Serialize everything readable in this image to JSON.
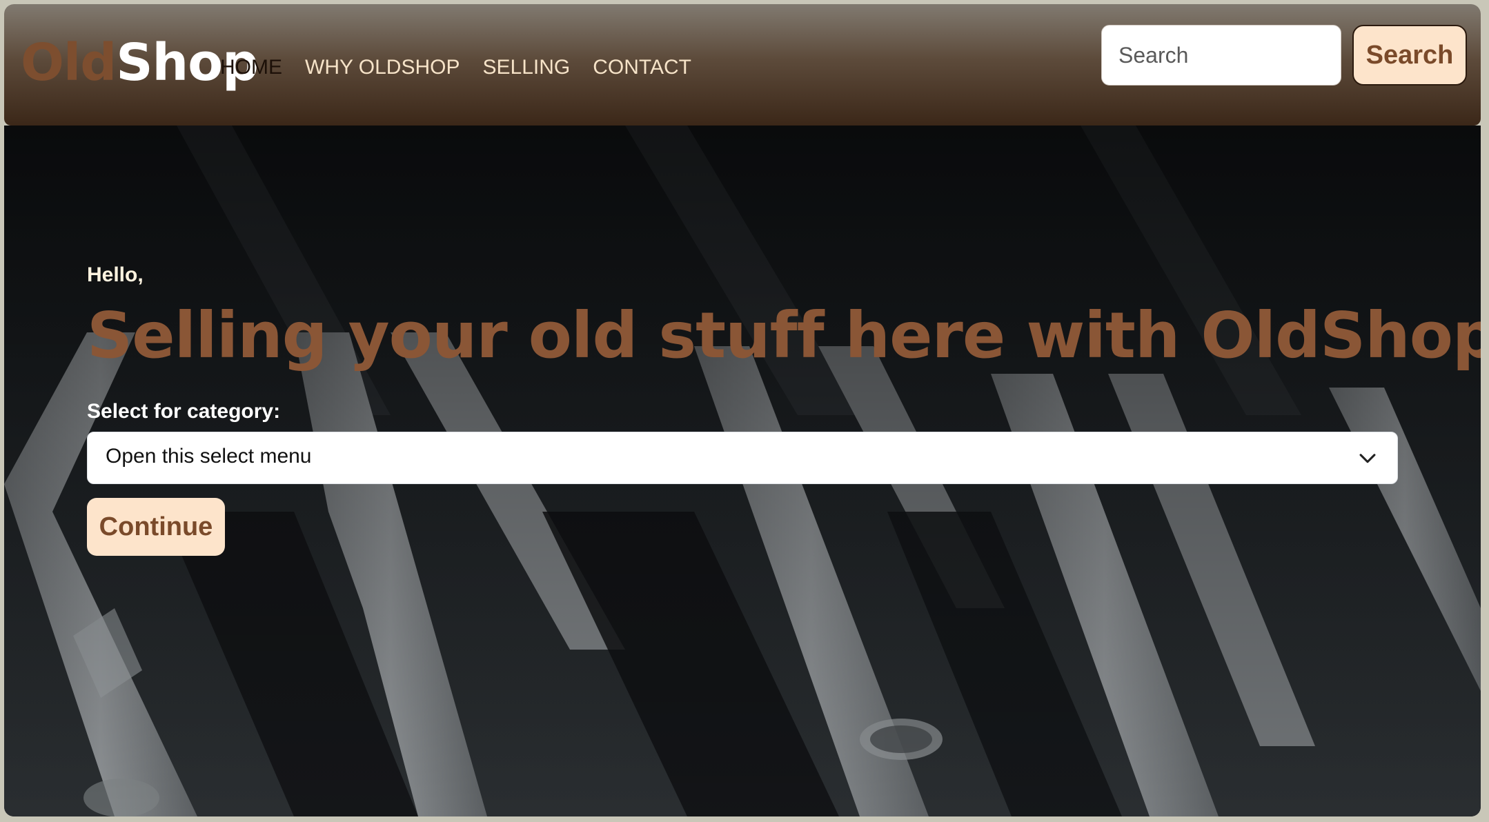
{
  "brand": {
    "part1": "Old",
    "part2": "Shop"
  },
  "nav": {
    "items": [
      {
        "label": "HOME",
        "active": true
      },
      {
        "label": "WHY OLDSHOP",
        "active": false
      },
      {
        "label": "SELLING",
        "active": false
      },
      {
        "label": "CONTACT",
        "active": false
      }
    ]
  },
  "search": {
    "placeholder": "Search",
    "value": "",
    "button_label": "Search"
  },
  "hero": {
    "greeting": "Hello,",
    "headline": "Selling your old stuff here with OldShop",
    "category_label": "Select for category:",
    "select_value": "Open this select menu",
    "continue_label": "Continue"
  },
  "colors": {
    "navbar_top": "#817a70",
    "navbar_bottom": "#3b2718",
    "brand_old": "#7d4e2f",
    "accent_button_bg": "#fde4cb",
    "accent_button_text": "#7a4a2a",
    "headline": "#8a5636"
  }
}
